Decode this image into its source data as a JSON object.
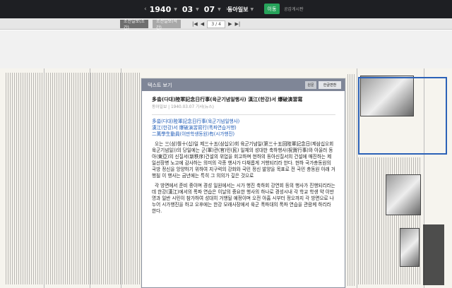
{
  "toolbar": {
    "year": "1940",
    "month": "03",
    "day": "07",
    "paper": "동아일보",
    "go_label": "이동",
    "notice": "공감게시판"
  },
  "subbar": {
    "tabs": [
      {
        "label": "조선일보(조간)"
      },
      {
        "label": "조선일보(석간)"
      }
    ],
    "current_page": "3",
    "total_pages": "4"
  },
  "panel": {
    "title": "텍스트 보기",
    "btn_a": "원문",
    "btn_b": "한글변환",
    "article_title": "多畓(다대)陸軍記念日行事(육군기념일행사) 漢江(한강)서 爆破演習寫",
    "meta": "동아일보 | 1940.03.07 기사(뉴스)",
    "lines": [
      "多畓(다대)陸軍記念日行事(육군기념일행사)",
      "漢江(한강)서 爆破演習寫行(폭파연습거행)",
      "二萬學生動員(이만학생동원)有(시가행진)"
    ],
    "para1": "오는 三(삼)월十(십)일 제三十五(삼십오)회 육군기념일(第三十五回陸軍記念日(제삼십오회육군기념일))의 당일에는 군(軍)관(官)민(民) 일체의 성대한 축하행사(祝賀行事)와 아울러 동아(東亞)의 신질서(新秩序)건설의 위업을 회고하며 현하의 동아신질서의 건설에 매진하는 제일선장병 노고에 감사하는 의미의 각종 행사가 다채롭게 거행되리라 한다. 현하 국가총동원의 국방 정신을 앙양하기 위하여 지구력의 강화와 국민 정신 발양을 목표로 전 국민 총동원 아래 거행될 이 행사는 금년에는 특히 그 의의가 깊은 것으로",
    "para2": "각 방면에서 준비 중이며 경성 일원에서는 시가 행진 축하회 강연회 등의 행사가 진행되리라는데 한강(漢江)에서의 폭파 연습은 이날의 중요한 행사의 하나로 경성시내 각 학교 학생 약 이만 명과 일반 시민이 참가하여 성대히 거행될 예정이며 오전 아홉 시부터 정오까지 각 방면으로 나누어 시가행진을 하고 오후에는 한강 모래사장에서 육군 폭파대의 폭파 연습을 관람케 하리라 한다."
  }
}
